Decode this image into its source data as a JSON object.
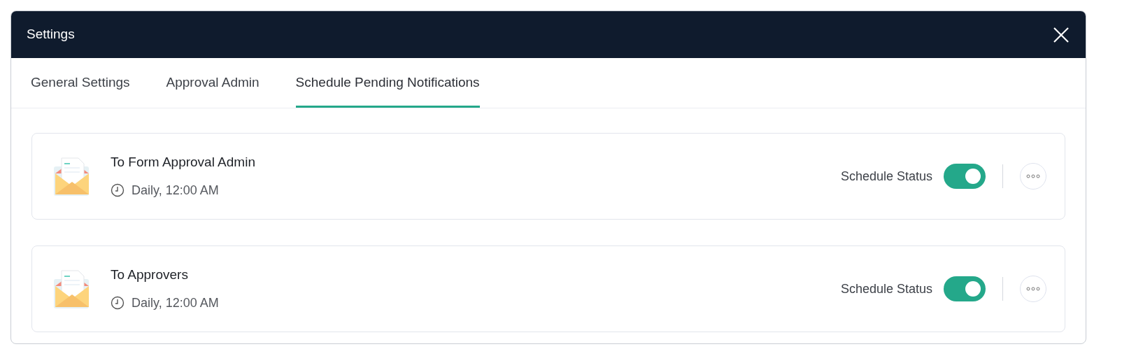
{
  "window": {
    "title": "Settings"
  },
  "tabs": [
    {
      "label": "General Settings",
      "selected": false
    },
    {
      "label": "Approval Admin",
      "selected": false
    },
    {
      "label": "Schedule Pending Notifications",
      "selected": true
    }
  ],
  "schedules": [
    {
      "title": "To Form Approval Admin",
      "frequency": "Daily, 12:00 AM",
      "status_label": "Schedule Status",
      "on": true
    },
    {
      "title": "To Approvers",
      "frequency": "Daily, 12:00 AM",
      "status_label": "Schedule Status",
      "on": true
    }
  ]
}
